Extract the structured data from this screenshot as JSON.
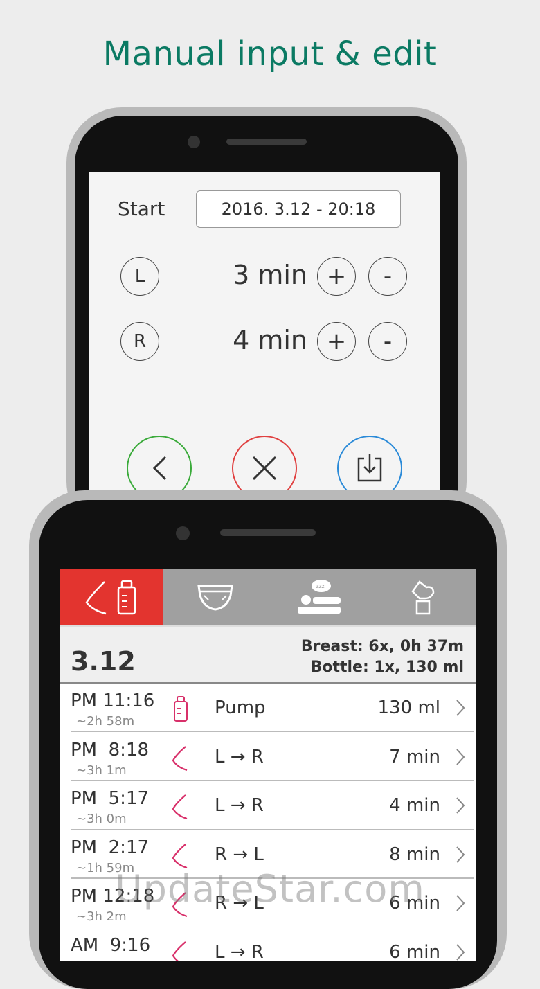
{
  "headline": "Manual input & edit",
  "edit": {
    "start_label": "Start",
    "start_value": "2016. 3.12 - 20:18",
    "sides": [
      {
        "side": "L",
        "duration": "3 min",
        "plus": "+",
        "minus": "-"
      },
      {
        "side": "R",
        "duration": "4 min",
        "plus": "+",
        "minus": "-"
      }
    ],
    "colors": {
      "back": "#3aaa3a",
      "cancel": "#e04040",
      "save": "#2a8ad8"
    }
  },
  "tabs": [
    {
      "name": "feeding",
      "icon": "breast-bottle-icon",
      "active": true
    },
    {
      "name": "diaper",
      "icon": "diaper-icon",
      "active": false
    },
    {
      "name": "sleep",
      "icon": "sleep-icon",
      "active": false
    },
    {
      "name": "pump",
      "icon": "breast-pump-icon",
      "active": false
    }
  ],
  "summary": {
    "date": "3.12",
    "breast": "Breast: 6x, 0h 37m",
    "bottle": "Bottle: 1x, 130 ml"
  },
  "entries": [
    {
      "time": "PM 11:16",
      "interval": "~2h 58m",
      "icon": "bottle-icon",
      "label": "Pump",
      "value": "130 ml"
    },
    {
      "time": "PM  8:18",
      "interval": "~3h 1m",
      "icon": "breast-icon",
      "label": "L → R",
      "value": "7 min"
    },
    {
      "time": "PM  5:17",
      "interval": "~3h 0m",
      "icon": "breast-icon",
      "label": "L → R",
      "value": "4 min"
    },
    {
      "time": "PM  2:17",
      "interval": "~1h 59m",
      "icon": "breast-icon",
      "label": "R → L",
      "value": "8 min"
    },
    {
      "time": "PM 12:18",
      "interval": "~3h 2m",
      "icon": "breast-icon",
      "label": "R → L",
      "value": "6 min"
    },
    {
      "time": "AM  9:16",
      "interval": "",
      "icon": "breast-icon",
      "label": "L → R",
      "value": "6 min"
    }
  ],
  "watermark": "UpdateStar.com",
  "colors": {
    "accent_red": "#e3342f",
    "icon_pink": "#d8306a",
    "headline": "#0b7a63"
  }
}
